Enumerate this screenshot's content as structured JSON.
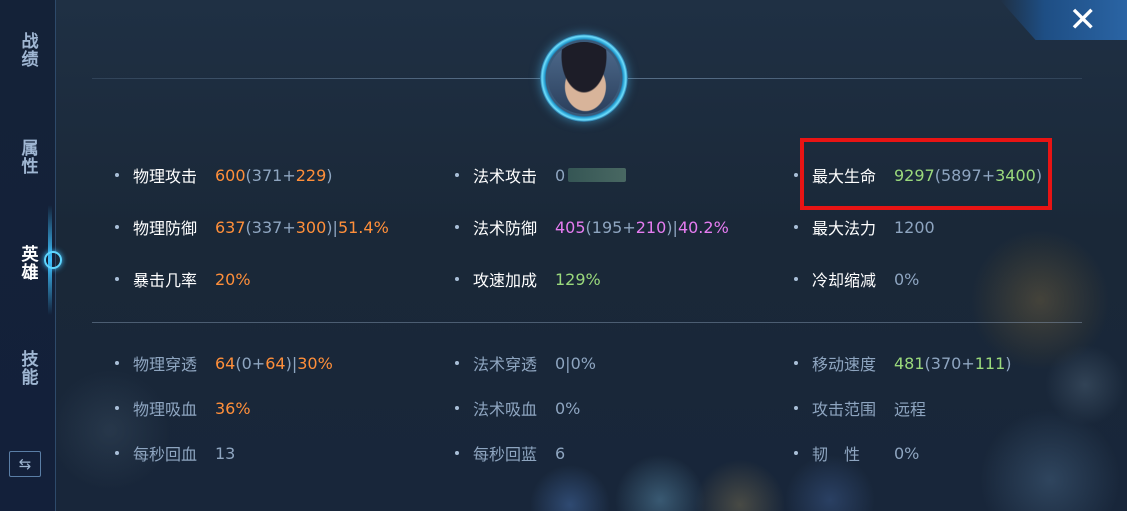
{
  "sidebar": {
    "tabs": [
      {
        "label": "战绩",
        "active": false
      },
      {
        "label": "属性",
        "active": false
      },
      {
        "label": "英雄",
        "active": true
      },
      {
        "label": "技能",
        "active": false
      }
    ],
    "swap_icon": "swap-arrows-icon"
  },
  "close_icon": "close-icon",
  "colors": {
    "accent": "#3fc2ff",
    "orange": "#ff8f3a",
    "green": "#9ad97c",
    "pink": "#e57cf0",
    "highlight": "#e81414"
  },
  "stats": {
    "phys_attack": {
      "label": "物理攻击",
      "total": "600",
      "open": "(",
      "base": "371",
      "plus": "+",
      "bonus": "229",
      "close": ")"
    },
    "magic_attack": {
      "label": "法术攻击",
      "value": "0"
    },
    "max_hp": {
      "label": "最大生命",
      "total": "9297",
      "open": "(",
      "base": "5897",
      "plus": "+",
      "bonus": "3400",
      "close": ")"
    },
    "phys_def": {
      "label": "物理防御",
      "total": "637",
      "open": "(",
      "base": "337",
      "plus": "+",
      "bonus": "300",
      "close": ")",
      "sep": "|",
      "pct": "51.4%"
    },
    "magic_def": {
      "label": "法术防御",
      "total": "405",
      "open": "(",
      "base": "195",
      "plus": "+",
      "bonus": "210",
      "close": ")",
      "sep": "|",
      "pct": "40.2%"
    },
    "max_mana": {
      "label": "最大法力",
      "value": "1200"
    },
    "crit_rate": {
      "label": "暴击几率",
      "value": "20%"
    },
    "attack_speed": {
      "label": "攻速加成",
      "value": "129%"
    },
    "cdr": {
      "label": "冷却缩减",
      "value": "0%"
    },
    "phys_pen": {
      "label": "物理穿透",
      "total": "64",
      "open": "(",
      "base": "0",
      "plus": "+",
      "bonus": "64",
      "close": ")",
      "sep": "|",
      "pct": "30%"
    },
    "magic_pen": {
      "label": "法术穿透",
      "value": "0|0%"
    },
    "move_speed": {
      "label": "移动速度",
      "total": "481",
      "open": "(",
      "base": "370",
      "plus": "+",
      "bonus": "111",
      "close": ")"
    },
    "lifesteal": {
      "label": "物理吸血",
      "value": "36%"
    },
    "spell_vamp": {
      "label": "法术吸血",
      "value": "0%"
    },
    "attack_range": {
      "label": "攻击范围",
      "value": "远程"
    },
    "hp_regen": {
      "label": "每秒回血",
      "value": "13"
    },
    "mana_regen": {
      "label": "每秒回蓝",
      "value": "6"
    },
    "tenacity": {
      "label": "韧　性",
      "value": "0%"
    }
  }
}
